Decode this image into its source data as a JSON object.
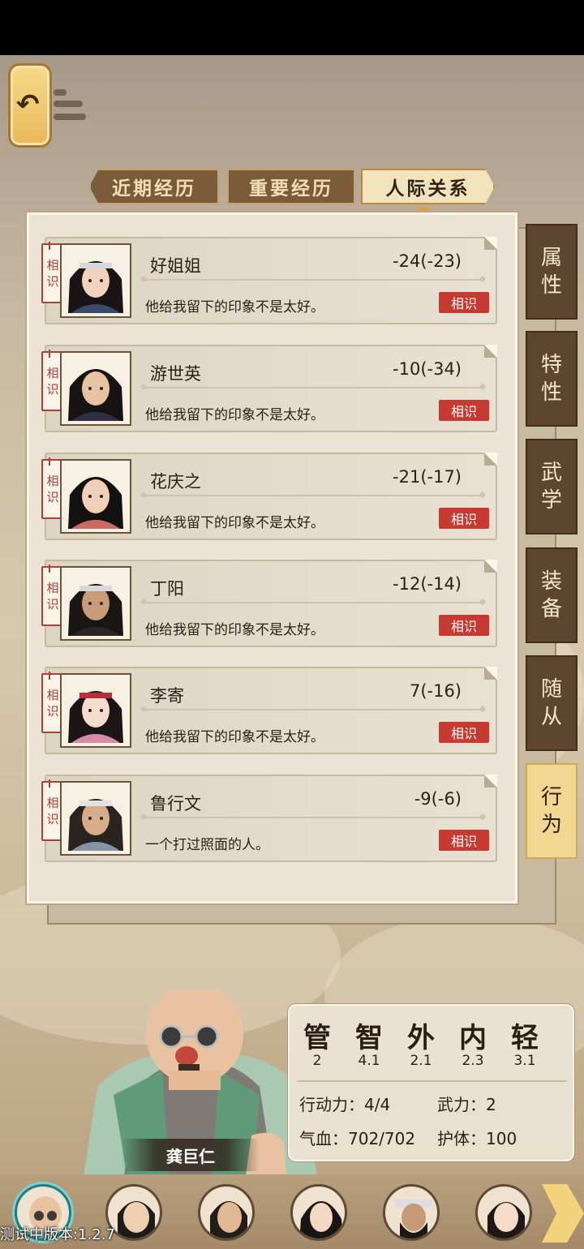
{
  "tabs": {
    "recent": "近期经历",
    "important": "重要经历",
    "relations": "人际关系"
  },
  "side_tabs": [
    {
      "chars": [
        "属",
        "性"
      ],
      "active": false
    },
    {
      "chars": [
        "特",
        "性"
      ],
      "active": false
    },
    {
      "chars": [
        "武",
        "学"
      ],
      "active": false
    },
    {
      "chars": [
        "装",
        "备"
      ],
      "active": false
    },
    {
      "chars": [
        "随",
        "从"
      ],
      "active": false
    },
    {
      "chars": [
        "行",
        "为"
      ],
      "active": true
    }
  ],
  "relations": [
    {
      "tag": [
        "相",
        "识"
      ],
      "name": "好姐姐",
      "score": "-24(-23)",
      "desc": "他给我留下的印象不是太好。",
      "badge": "相识"
    },
    {
      "tag": [
        "相",
        "识"
      ],
      "name": "游世英",
      "score": "-10(-34)",
      "desc": "他给我留下的印象不是太好。",
      "badge": "相识"
    },
    {
      "tag": [
        "相",
        "识"
      ],
      "name": "花庆之",
      "score": "-21(-17)",
      "desc": "他给我留下的印象不是太好。",
      "badge": "相识"
    },
    {
      "tag": [
        "相",
        "识"
      ],
      "name": "丁阳",
      "score": "-12(-14)",
      "desc": "他给我留下的印象不是太好。",
      "badge": "相识"
    },
    {
      "tag": [
        "相",
        "识"
      ],
      "name": "李寄",
      "score": "7(-16)",
      "desc": "他给我留下的印象不是太好。",
      "badge": "相识"
    },
    {
      "tag": [
        "相",
        "识"
      ],
      "name": "鲁行文",
      "score": "-9(-6)",
      "desc": "一个打过照面的人。",
      "badge": "相识"
    }
  ],
  "stats": {
    "heads": [
      "管",
      "智",
      "外",
      "内",
      "轻"
    ],
    "values": [
      "2",
      "4.1",
      "2.1",
      "2.3",
      "3.1"
    ],
    "action": "行动力：4/4",
    "martial": "武力：2",
    "hp": "气血：702/702",
    "guard": "护体：100"
  },
  "character": {
    "name": "龚巨仁"
  },
  "version": "测试中版本:1.2.7",
  "colors": {
    "accent_red": "#c63a32",
    "panel_brown": "#5e4530",
    "active_gold": "#f1d792"
  }
}
